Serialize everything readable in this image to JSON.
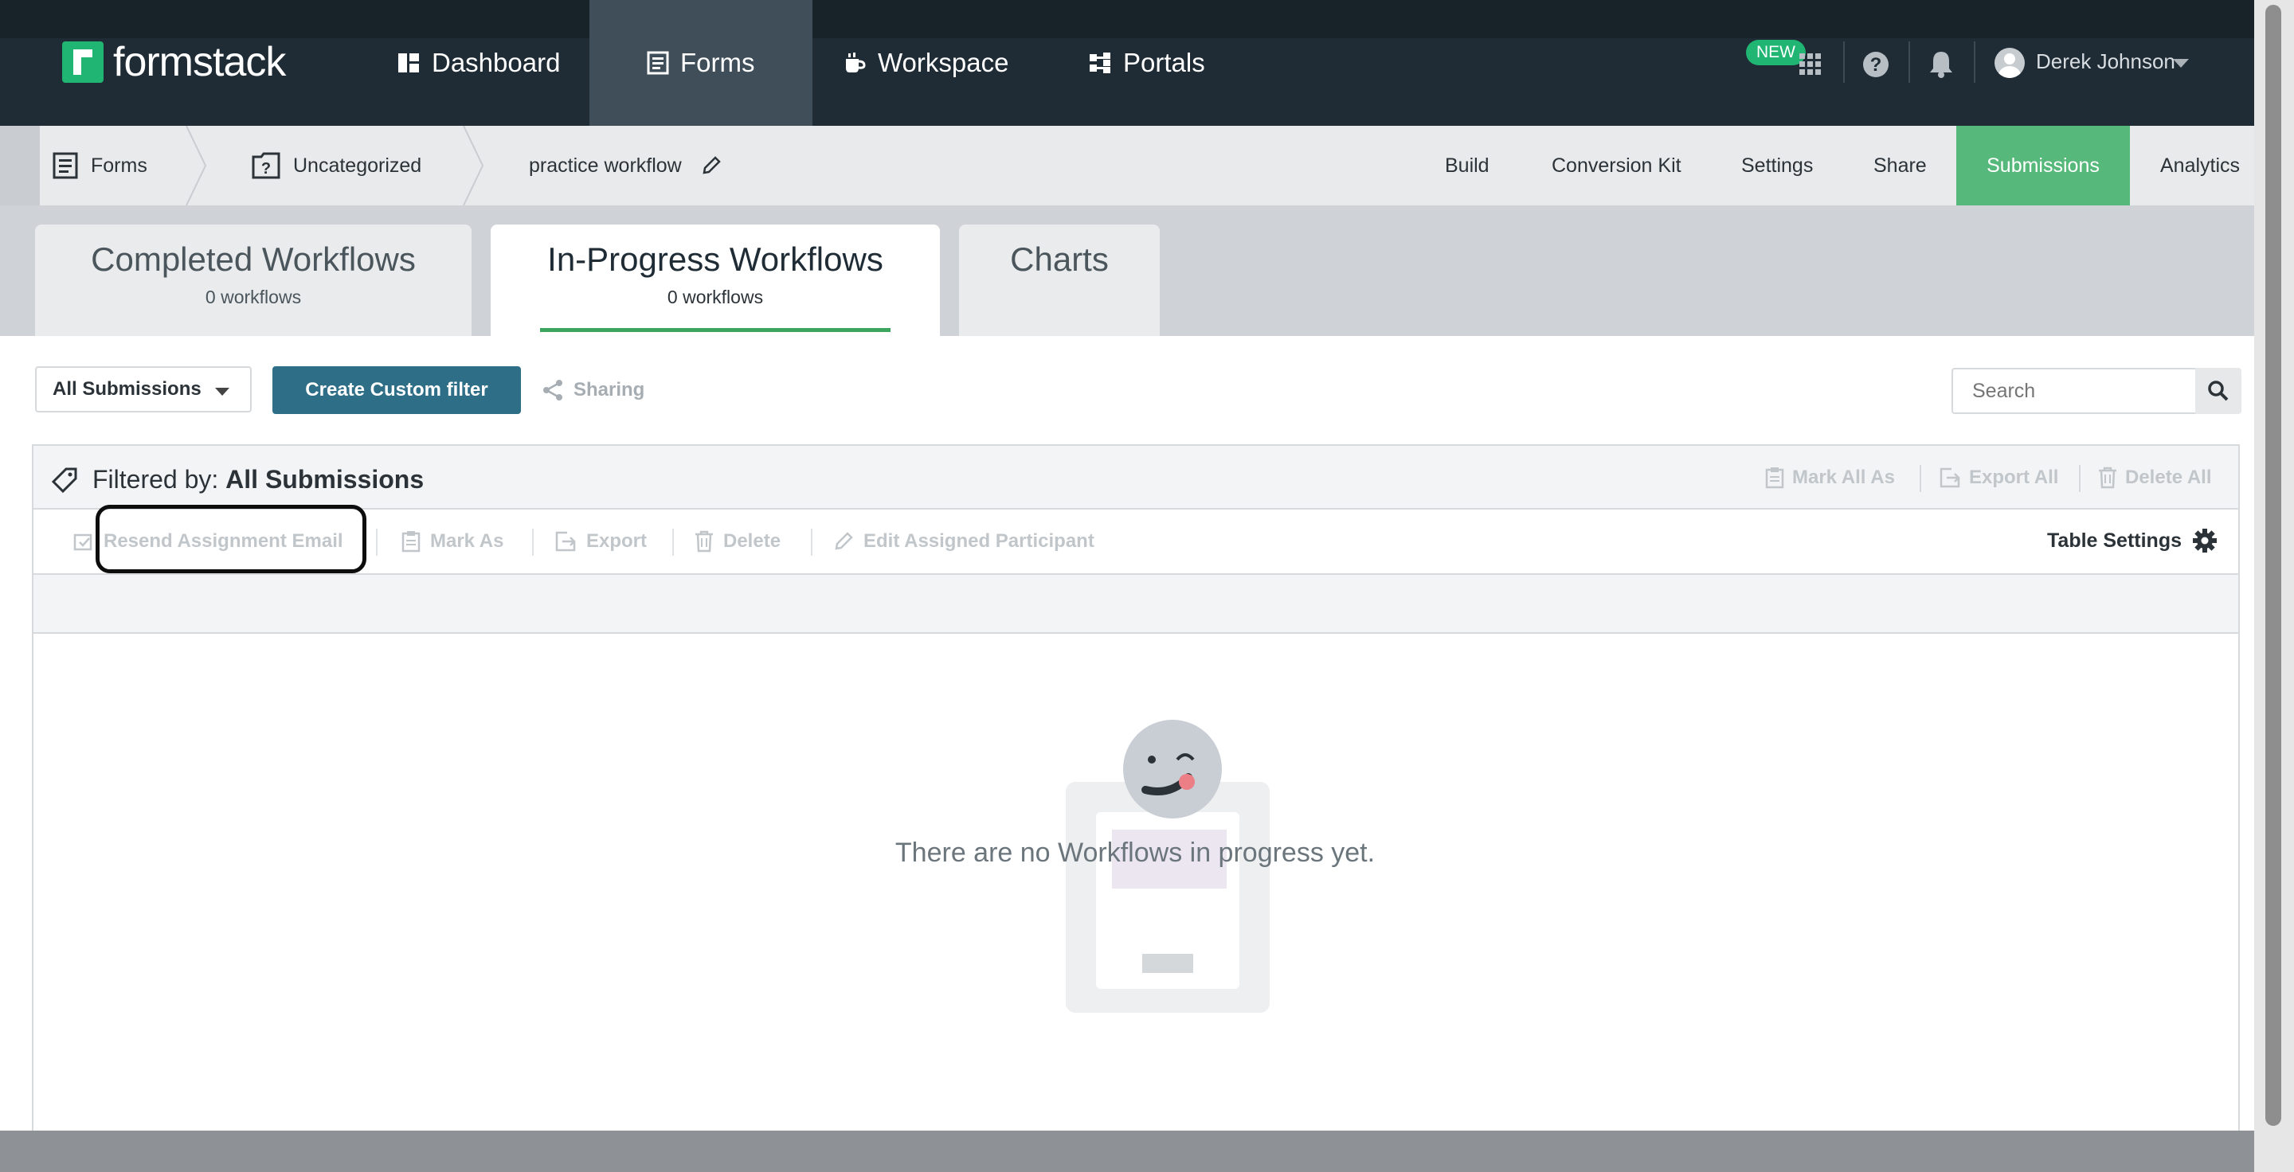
{
  "nav": {
    "logo": "formstack",
    "items": [
      {
        "label": "Dashboard",
        "icon": "dashboard-icon"
      },
      {
        "label": "Forms",
        "icon": "forms-icon"
      },
      {
        "label": "Workspace",
        "icon": "workspace-icon"
      },
      {
        "label": "Portals",
        "icon": "portals-icon"
      }
    ],
    "new_badge": "NEW",
    "user": "Derek Johnson"
  },
  "breadcrumb": {
    "items": [
      {
        "label": "Forms",
        "icon": "forms-icon"
      },
      {
        "label": "Uncategorized",
        "icon": "folder-question-icon"
      },
      {
        "label": "practice workflow",
        "icon": "pencil-icon"
      }
    ]
  },
  "form_tabs": [
    "Build",
    "Conversion Kit",
    "Settings",
    "Share",
    "Submissions",
    "Analytics"
  ],
  "active_form_tab": "Submissions",
  "workflow_tabs": [
    {
      "title": "Completed Workflows",
      "count": "0 workflows"
    },
    {
      "title": "In-Progress Workflows",
      "count": "0 workflows"
    },
    {
      "title": "Charts",
      "count": ""
    }
  ],
  "active_workflow_tab": "In-Progress Workflows",
  "filters": {
    "selected": "All Submissions",
    "create_button": "Create Custom filter",
    "sharing": "Sharing",
    "search_placeholder": "Search"
  },
  "panel": {
    "filtered_label": "Filtered by:",
    "filtered_value": "All Submissions",
    "bulk_actions": [
      "Mark All As",
      "Export All",
      "Delete All"
    ],
    "row_actions": [
      "Resend Assignment Email",
      "Mark As",
      "Export",
      "Delete",
      "Edit Assigned Participant"
    ],
    "table_settings": "Table Settings",
    "empty_message": "There are no Workflows in progress yet."
  },
  "colors": {
    "nav_bg": "#1f2c35",
    "accent_green": "#56b87a",
    "primary_button": "#2e6f87",
    "logo_green": "#21b573"
  }
}
